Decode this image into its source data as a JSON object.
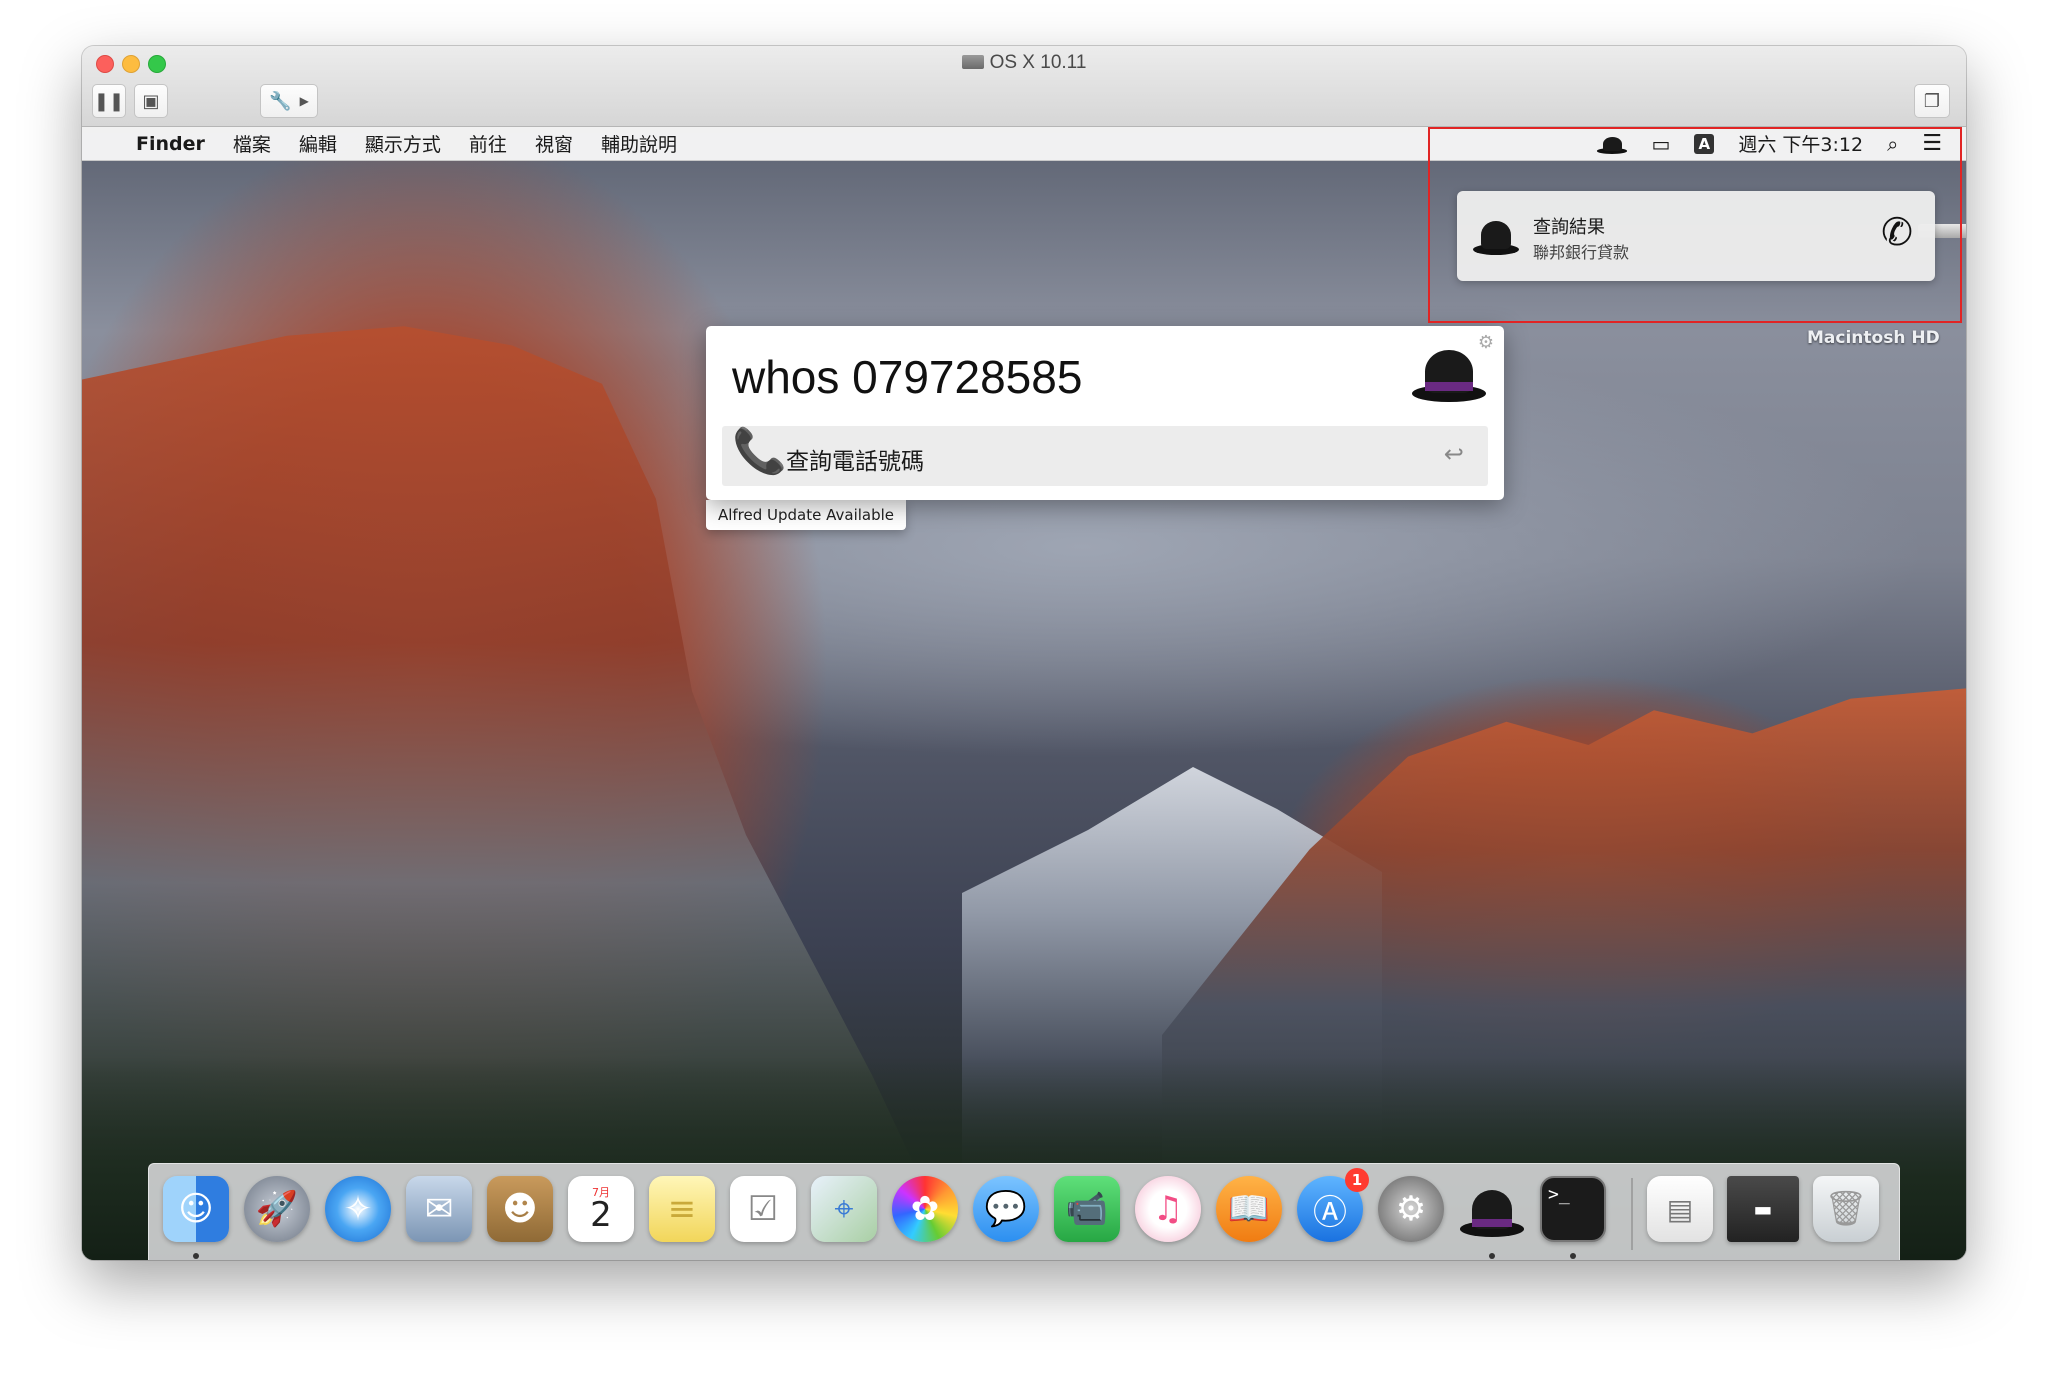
{
  "window": {
    "title": "OS X 10.11",
    "toolbar": {
      "pause_icon": "pause-icon",
      "snapshot_icon": "snapshot-icon",
      "settings_icon": "wrench-icon",
      "more_icon": "triangle-right-icon",
      "window_icon": "restore-window-icon"
    }
  },
  "menubar": {
    "app_name": "Finder",
    "items": [
      "檔案",
      "編輯",
      "顯示方式",
      "前往",
      "視窗",
      "輔助說明"
    ],
    "status": {
      "input_method": "A",
      "clock": "週六 下午3:12"
    }
  },
  "notification": {
    "title": "查詢結果",
    "body": "聯邦銀行貸款"
  },
  "desktop": {
    "drive_label": "Macintosh HD"
  },
  "alfred": {
    "query": "whos 079728585",
    "result_label": "查詢電話號碼",
    "update_notice": "Alfred Update Available"
  },
  "dock": {
    "calendar_month": "7月",
    "calendar_day": "2",
    "appstore_badge": "1",
    "items": [
      {
        "name": "Finder",
        "color": "#3b8ee8"
      },
      {
        "name": "Launchpad",
        "color": "#7d8796"
      },
      {
        "name": "Safari",
        "color": "#1f7fe0"
      },
      {
        "name": "Mail",
        "color": "#9fb6cf"
      },
      {
        "name": "Contacts",
        "color": "#b88a4e"
      },
      {
        "name": "Calendar",
        "color": "#ffffff"
      },
      {
        "name": "Notes",
        "color": "#f7e27a"
      },
      {
        "name": "Reminders",
        "color": "#ffffff"
      },
      {
        "name": "Maps",
        "color": "#8fc98a"
      },
      {
        "name": "Photos",
        "color": "#ffffff"
      },
      {
        "name": "Messages",
        "color": "#4aa3f5"
      },
      {
        "name": "FaceTime",
        "color": "#3fc25a"
      },
      {
        "name": "iTunes",
        "color": "#f24d85"
      },
      {
        "name": "iBooks",
        "color": "#f39a2b"
      },
      {
        "name": "App Store",
        "color": "#2d8df2"
      },
      {
        "name": "System Preferences",
        "color": "#6f6f6f"
      },
      {
        "name": "Alfred",
        "color": "#2c2c2c"
      },
      {
        "name": "Terminal",
        "color": "#1b1b1b"
      }
    ]
  }
}
